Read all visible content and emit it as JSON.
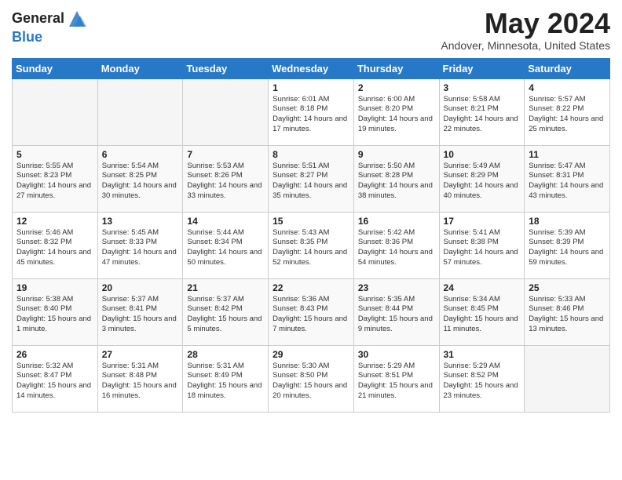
{
  "header": {
    "logo_line1": "General",
    "logo_line2": "Blue",
    "month": "May 2024",
    "location": "Andover, Minnesota, United States"
  },
  "days_of_week": [
    "Sunday",
    "Monday",
    "Tuesday",
    "Wednesday",
    "Thursday",
    "Friday",
    "Saturday"
  ],
  "weeks": [
    [
      {
        "day": "",
        "info": ""
      },
      {
        "day": "",
        "info": ""
      },
      {
        "day": "",
        "info": ""
      },
      {
        "day": "1",
        "info": "Sunrise: 6:01 AM\nSunset: 8:18 PM\nDaylight: 14 hours\nand 17 minutes."
      },
      {
        "day": "2",
        "info": "Sunrise: 6:00 AM\nSunset: 8:20 PM\nDaylight: 14 hours\nand 19 minutes."
      },
      {
        "day": "3",
        "info": "Sunrise: 5:58 AM\nSunset: 8:21 PM\nDaylight: 14 hours\nand 22 minutes."
      },
      {
        "day": "4",
        "info": "Sunrise: 5:57 AM\nSunset: 8:22 PM\nDaylight: 14 hours\nand 25 minutes."
      }
    ],
    [
      {
        "day": "5",
        "info": "Sunrise: 5:55 AM\nSunset: 8:23 PM\nDaylight: 14 hours\nand 27 minutes."
      },
      {
        "day": "6",
        "info": "Sunrise: 5:54 AM\nSunset: 8:25 PM\nDaylight: 14 hours\nand 30 minutes."
      },
      {
        "day": "7",
        "info": "Sunrise: 5:53 AM\nSunset: 8:26 PM\nDaylight: 14 hours\nand 33 minutes."
      },
      {
        "day": "8",
        "info": "Sunrise: 5:51 AM\nSunset: 8:27 PM\nDaylight: 14 hours\nand 35 minutes."
      },
      {
        "day": "9",
        "info": "Sunrise: 5:50 AM\nSunset: 8:28 PM\nDaylight: 14 hours\nand 38 minutes."
      },
      {
        "day": "10",
        "info": "Sunrise: 5:49 AM\nSunset: 8:29 PM\nDaylight: 14 hours\nand 40 minutes."
      },
      {
        "day": "11",
        "info": "Sunrise: 5:47 AM\nSunset: 8:31 PM\nDaylight: 14 hours\nand 43 minutes."
      }
    ],
    [
      {
        "day": "12",
        "info": "Sunrise: 5:46 AM\nSunset: 8:32 PM\nDaylight: 14 hours\nand 45 minutes."
      },
      {
        "day": "13",
        "info": "Sunrise: 5:45 AM\nSunset: 8:33 PM\nDaylight: 14 hours\nand 47 minutes."
      },
      {
        "day": "14",
        "info": "Sunrise: 5:44 AM\nSunset: 8:34 PM\nDaylight: 14 hours\nand 50 minutes."
      },
      {
        "day": "15",
        "info": "Sunrise: 5:43 AM\nSunset: 8:35 PM\nDaylight: 14 hours\nand 52 minutes."
      },
      {
        "day": "16",
        "info": "Sunrise: 5:42 AM\nSunset: 8:36 PM\nDaylight: 14 hours\nand 54 minutes."
      },
      {
        "day": "17",
        "info": "Sunrise: 5:41 AM\nSunset: 8:38 PM\nDaylight: 14 hours\nand 57 minutes."
      },
      {
        "day": "18",
        "info": "Sunrise: 5:39 AM\nSunset: 8:39 PM\nDaylight: 14 hours\nand 59 minutes."
      }
    ],
    [
      {
        "day": "19",
        "info": "Sunrise: 5:38 AM\nSunset: 8:40 PM\nDaylight: 15 hours\nand 1 minute."
      },
      {
        "day": "20",
        "info": "Sunrise: 5:37 AM\nSunset: 8:41 PM\nDaylight: 15 hours\nand 3 minutes."
      },
      {
        "day": "21",
        "info": "Sunrise: 5:37 AM\nSunset: 8:42 PM\nDaylight: 15 hours\nand 5 minutes."
      },
      {
        "day": "22",
        "info": "Sunrise: 5:36 AM\nSunset: 8:43 PM\nDaylight: 15 hours\nand 7 minutes."
      },
      {
        "day": "23",
        "info": "Sunrise: 5:35 AM\nSunset: 8:44 PM\nDaylight: 15 hours\nand 9 minutes."
      },
      {
        "day": "24",
        "info": "Sunrise: 5:34 AM\nSunset: 8:45 PM\nDaylight: 15 hours\nand 11 minutes."
      },
      {
        "day": "25",
        "info": "Sunrise: 5:33 AM\nSunset: 8:46 PM\nDaylight: 15 hours\nand 13 minutes."
      }
    ],
    [
      {
        "day": "26",
        "info": "Sunrise: 5:32 AM\nSunset: 8:47 PM\nDaylight: 15 hours\nand 14 minutes."
      },
      {
        "day": "27",
        "info": "Sunrise: 5:31 AM\nSunset: 8:48 PM\nDaylight: 15 hours\nand 16 minutes."
      },
      {
        "day": "28",
        "info": "Sunrise: 5:31 AM\nSunset: 8:49 PM\nDaylight: 15 hours\nand 18 minutes."
      },
      {
        "day": "29",
        "info": "Sunrise: 5:30 AM\nSunset: 8:50 PM\nDaylight: 15 hours\nand 20 minutes."
      },
      {
        "day": "30",
        "info": "Sunrise: 5:29 AM\nSunset: 8:51 PM\nDaylight: 15 hours\nand 21 minutes."
      },
      {
        "day": "31",
        "info": "Sunrise: 5:29 AM\nSunset: 8:52 PM\nDaylight: 15 hours\nand 23 minutes."
      },
      {
        "day": "",
        "info": ""
      }
    ]
  ]
}
